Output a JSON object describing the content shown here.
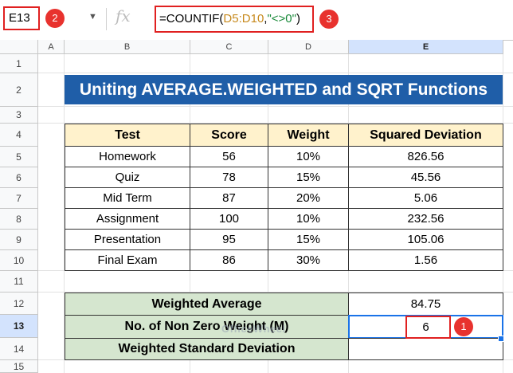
{
  "formula_bar": {
    "name_box": "E13",
    "dropdown_icon": "chevron-down-icon",
    "fx_label": "fx",
    "formula_prefix": "=COUNTIF(",
    "formula_ref": "D5:D10",
    "formula_sep": ",",
    "formula_str": "\"<>0\"",
    "formula_suffix": ")"
  },
  "badges": {
    "b1": "1",
    "b2": "2",
    "b3": "3"
  },
  "colors": {
    "title_bg": "#1f5ea8",
    "header_bg": "#fff2cc",
    "green_bg": "#d5e6cf",
    "badge_red": "#e8322e",
    "selection_blue": "#1a73e8"
  },
  "columns": [
    "A",
    "B",
    "C",
    "D",
    "E"
  ],
  "rows": [
    "1",
    "2",
    "3",
    "4",
    "5",
    "6",
    "7",
    "8",
    "9",
    "10",
    "11",
    "12",
    "13",
    "14",
    "15"
  ],
  "title": "Uniting AVERAGE.WEIGHTED and SQRT Functions",
  "table": {
    "headers": [
      "Test",
      "Score",
      "Weight",
      "Squared Deviation"
    ],
    "rows": [
      [
        "Homework",
        "56",
        "10%",
        "826.56"
      ],
      [
        "Quiz",
        "78",
        "15%",
        "45.56"
      ],
      [
        "Mid Term",
        "87",
        "20%",
        "5.06"
      ],
      [
        "Assignment",
        "100",
        "10%",
        "232.56"
      ],
      [
        "Presentation",
        "95",
        "15%",
        "105.06"
      ],
      [
        "Final Exam",
        "86",
        "30%",
        "1.56"
      ]
    ]
  },
  "summary": [
    {
      "label": "Weighted Average",
      "value": "84.75"
    },
    {
      "label": "No. of Non Zero Weight (M)",
      "value": "6"
    },
    {
      "label": "Weighted Standard Deviation",
      "value": ""
    }
  ],
  "watermark": "OfficeWheel"
}
